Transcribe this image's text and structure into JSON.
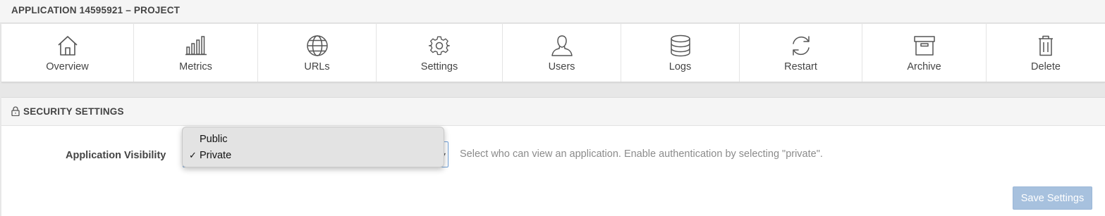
{
  "header": {
    "title": "APPLICATION 14595921 – PROJECT"
  },
  "toolbar": {
    "items": [
      {
        "label": "Overview",
        "icon": "home-icon"
      },
      {
        "label": "Metrics",
        "icon": "bar-chart-icon"
      },
      {
        "label": "URLs",
        "icon": "globe-icon"
      },
      {
        "label": "Settings",
        "icon": "gear-icon"
      },
      {
        "label": "Users",
        "icon": "user-icon"
      },
      {
        "label": "Logs",
        "icon": "database-icon"
      },
      {
        "label": "Restart",
        "icon": "refresh-icon"
      },
      {
        "label": "Archive",
        "icon": "archive-box-icon"
      },
      {
        "label": "Delete",
        "icon": "trash-icon"
      }
    ]
  },
  "security": {
    "title": "SECURITY SETTINGS",
    "icon": "lock-icon",
    "visibility_label": "Application Visibility",
    "visibility_value": "Private",
    "visibility_options": [
      "Public",
      "Private"
    ],
    "help_text": "Select who can view an application. Enable authentication by selecting \"private\".",
    "save_label": "Save Settings",
    "check_mark": "✓"
  },
  "colors": {
    "save_button": "#a7c1de",
    "select_border": "#6f9fd6",
    "header_bg": "#f5f5f5"
  }
}
